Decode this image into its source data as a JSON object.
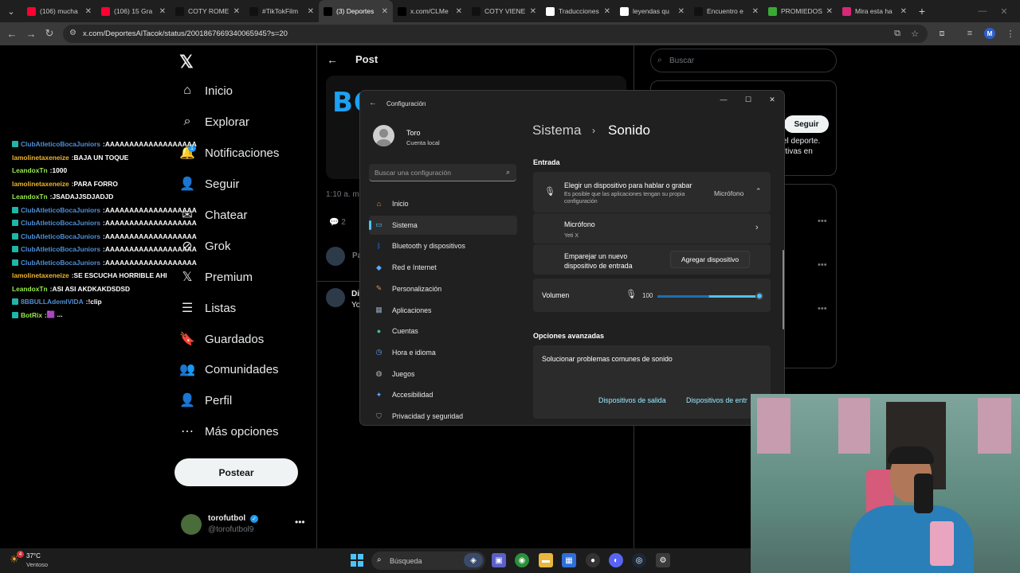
{
  "browser": {
    "tabs": [
      {
        "label": "(106) mucha",
        "icon": "youtube-icon",
        "color": "#ff0033"
      },
      {
        "label": "(106) 15 Gra",
        "icon": "youtube-icon",
        "color": "#ff0033"
      },
      {
        "label": "COTY ROME",
        "icon": "tiktok-icon",
        "color": "#111111"
      },
      {
        "label": "#TikTokFilm",
        "icon": "tiktok-icon",
        "color": "#111111"
      },
      {
        "label": "(3) Deportes",
        "icon": "x-icon",
        "color": "#000000",
        "active": true
      },
      {
        "label": "x.com/CLMe",
        "icon": "x-icon",
        "color": "#000000"
      },
      {
        "label": "COTY VIENE",
        "icon": "tiktok-icon",
        "color": "#111111"
      },
      {
        "label": "Traducciones",
        "icon": "translate-icon",
        "color": "#ffffff"
      },
      {
        "label": "leyendas qu",
        "icon": "google-icon",
        "color": "#ffffff"
      },
      {
        "label": "Encuentro e",
        "icon": "tiktok-icon",
        "color": "#111111"
      },
      {
        "label": "PROMIEDOS",
        "icon": "promiedos-icon",
        "color": "#3aa935"
      },
      {
        "label": "Mira esta ha",
        "icon": "instagram-icon",
        "color": "#d62976"
      }
    ],
    "url": "x.com/DeportesAlTacok/status/2001867669340065945?s=20",
    "profile_initial": "M"
  },
  "x": {
    "nav": [
      {
        "label": "Inicio",
        "icon": "home-icon"
      },
      {
        "label": "Explorar",
        "icon": "search-icon"
      },
      {
        "label": "Notificaciones",
        "icon": "bell-icon"
      },
      {
        "label": "Seguir",
        "icon": "follow-icon"
      },
      {
        "label": "Chatear",
        "icon": "chat-icon"
      },
      {
        "label": "Grok",
        "icon": "grok-icon"
      },
      {
        "label": "Premium",
        "icon": "x-logo-icon"
      },
      {
        "label": "Listas",
        "icon": "list-icon"
      },
      {
        "label": "Guardados",
        "icon": "bookmark-icon"
      },
      {
        "label": "Comunidades",
        "icon": "communities-icon"
      },
      {
        "label": "Perfil",
        "icon": "profile-icon"
      },
      {
        "label": "Más opciones",
        "icon": "more-icon"
      }
    ],
    "notif_count": "1",
    "post_button": "Postear",
    "account": {
      "name": "torofutbol",
      "handle": "@torofutbol9"
    },
    "post_header": "Post",
    "media_text": "BO",
    "time_fragment": "1:10 a. m.",
    "reply_count": "2",
    "search_placeholder": "Buscar",
    "follow_button": "Seguir",
    "card_fragment_1": "el deporte.",
    "card_fragment_2": "rtivas en",
    "reply_fragment_1": "Pa",
    "reply_fragment_2": "Di",
    "reply_fragment_3": "Yo"
  },
  "chat": [
    {
      "user": "ClubAtleticoBocaJuniors",
      "msg": "AAAAAAAAAAAAAAAAAAA",
      "color": "#4f8fd6",
      "badge": true
    },
    {
      "user": "lamolinetaxeneize",
      "msg": "BAJA UN TOQUE",
      "color": "#f0b429",
      "badge": false
    },
    {
      "user": "LeandoxTn",
      "msg": "1000",
      "color": "#9bea4d",
      "badge": false
    },
    {
      "user": "lamolinetaxeneize",
      "msg": "PARA FORRO",
      "color": "#f0b429",
      "badge": false
    },
    {
      "user": "LeandoxTn",
      "msg": "JSADAJJSDJADJD",
      "color": "#9bea4d",
      "badge": false
    },
    {
      "user": "ClubAtleticoBocaJuniors",
      "msg": "AAAAAAAAAAAAAAAAAAAAA",
      "color": "#4f8fd6",
      "badge": true
    },
    {
      "user": "ClubAtleticoBocaJuniors",
      "msg": "AAAAAAAAAAAAAAAAAAAAA",
      "color": "#4f8fd6",
      "badge": true
    },
    {
      "user": "ClubAtleticoBocaJuniors",
      "msg": "AAAAAAAAAAAAAAAAAAAAA",
      "color": "#4f8fd6",
      "badge": true
    },
    {
      "user": "ClubAtleticoBocaJuniors",
      "msg": "AAAAAAAAAAAAAAAAAAAAA",
      "color": "#4f8fd6",
      "badge": true
    },
    {
      "user": "ClubAtleticoBocaJuniors",
      "msg": "AAAAAAAAAAAAAAAAAAAAA",
      "color": "#4f8fd6",
      "badge": true
    },
    {
      "user": "lamolinetaxeneize",
      "msg": "SE ESCUCHA HORRIBLE AHI",
      "color": "#f0b429",
      "badge": false
    },
    {
      "user": "LeandoxTn",
      "msg": "ASI ASI AKDKAKDSDSD",
      "color": "#9bea4d",
      "badge": false
    },
    {
      "user": "8BBULLAdemIVIDA",
      "msg": "!clip",
      "color": "#4f8fd6",
      "badge": true
    },
    {
      "user": "BotRix",
      "msg": "🟪 ...",
      "color": "#9bea4d",
      "badge": true
    }
  ],
  "settings": {
    "window_title": "Configuración",
    "user_name": "Toro",
    "user_sub": "Cuenta local",
    "search_placeholder": "Buscar una configuración",
    "nav": [
      {
        "label": "Inicio",
        "icon": "home-icon",
        "color": "#e6a23c"
      },
      {
        "label": "Sistema",
        "icon": "system-icon",
        "color": "#4cc2ff",
        "selected": true
      },
      {
        "label": "Bluetooth y dispositivos",
        "icon": "bluetooth-icon",
        "color": "#0a84ff"
      },
      {
        "label": "Red e Internet",
        "icon": "wifi-icon",
        "color": "#5aa9ff"
      },
      {
        "label": "Personalización",
        "icon": "brush-icon",
        "color": "#e0904a"
      },
      {
        "label": "Aplicaciones",
        "icon": "apps-icon",
        "color": "#8fa3b8"
      },
      {
        "label": "Cuentas",
        "icon": "account-icon",
        "color": "#3fc48a"
      },
      {
        "label": "Hora e idioma",
        "icon": "globe-clock-icon",
        "color": "#5aa9ff"
      },
      {
        "label": "Juegos",
        "icon": "gamepad-icon",
        "color": "#b8b8b8"
      },
      {
        "label": "Accesibilidad",
        "icon": "accessibility-icon",
        "color": "#5aa9ff"
      },
      {
        "label": "Privacidad y seguridad",
        "icon": "shield-icon",
        "color": "#9a9a9a"
      }
    ],
    "breadcrumb_parent": "Sistema",
    "breadcrumb_current": "Sonido",
    "section_input": "Entrada",
    "choose_device_title": "Elegir un dispositivo para hablar o grabar",
    "choose_device_sub": "Es posible que las aplicaciones tengan su propia configuración",
    "choose_device_value": "Micrófono",
    "mic_name": "Micrófono",
    "mic_sub": "Yeti X",
    "pair_text": "Emparejar un nuevo dispositivo de entrada",
    "add_device_button": "Agregar dispositivo",
    "volume_label": "Volumen",
    "volume_value": "100",
    "volume_fraction": 0.52,
    "section_advanced": "Opciones avanzadas",
    "troubleshoot_title": "Solucionar problemas comunes de sonido",
    "link_output": "Dispositivos de salida",
    "link_input": "Dispositivos de entr"
  },
  "taskbar": {
    "temp": "37°C",
    "weather": "Ventoso",
    "weather_badge": "4",
    "search": "Búsqueda"
  }
}
